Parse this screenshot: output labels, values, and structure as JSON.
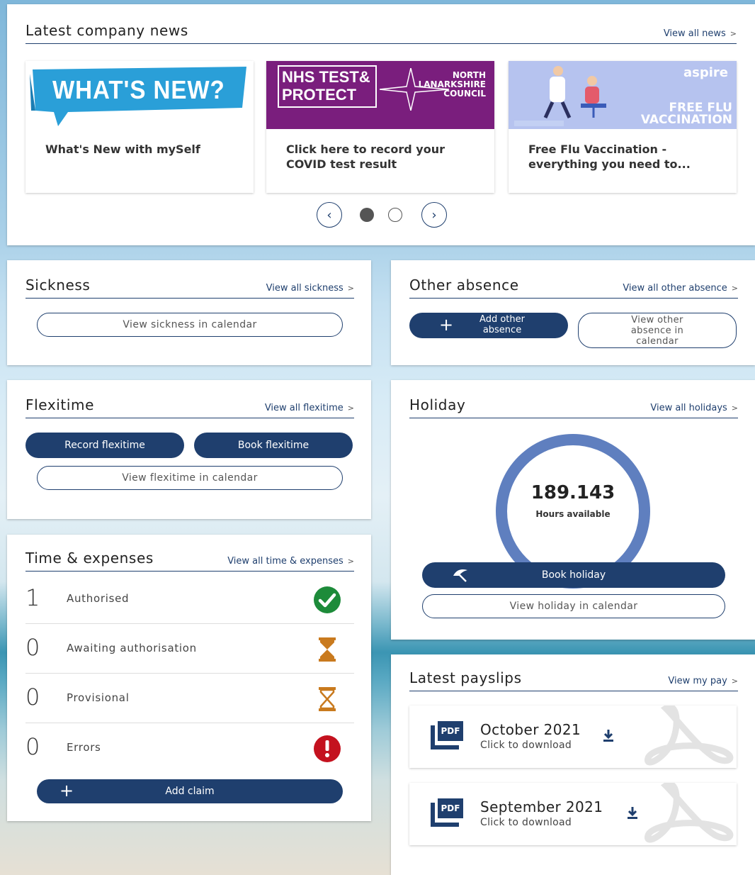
{
  "news": {
    "title": "Latest company news",
    "link": "View all news",
    "items": [
      {
        "image_text": "WHAT'S NEW?",
        "caption": "What's New with mySelf"
      },
      {
        "image_text_1": "NHS TEST& PROTECT",
        "image_text_2": "NORTH LANARKSHIRE COUNCIL",
        "caption": "Click here to record your COVID test result"
      },
      {
        "image_text_1": "aspire",
        "image_text_2": "FREE FLU VACCINATION",
        "caption": "Free Flu Vaccination - everything you need to..."
      }
    ]
  },
  "sickness": {
    "title": "Sickness",
    "link": "View all sickness",
    "calendar_button": "View sickness in calendar"
  },
  "other_absence": {
    "title": "Other absence",
    "link": "View all other absence",
    "add_button": "Add other absence",
    "calendar_button": "View other absence in calendar"
  },
  "flexitime": {
    "title": "Flexitime",
    "link": "View all flexitime",
    "record_button": "Record flexitime",
    "book_button": "Book flexitime",
    "calendar_button": "View flexitime in calendar"
  },
  "holiday": {
    "title": "Holiday",
    "link": "View all holidays",
    "hours": "189.143",
    "hours_label": "Hours available",
    "book_button": "Book holiday",
    "calendar_button": "View holiday in calendar"
  },
  "time_expenses": {
    "title": "Time & expenses",
    "link": "View all time & expenses",
    "rows": [
      {
        "count": "1",
        "label": "Authorised",
        "icon": "check-circle-icon"
      },
      {
        "count": "0",
        "label": "Awaiting authorisation",
        "icon": "hourglass-full-icon"
      },
      {
        "count": "0",
        "label": "Provisional",
        "icon": "hourglass-outline-icon"
      },
      {
        "count": "0",
        "label": "Errors",
        "icon": "error-circle-icon"
      }
    ],
    "add_button": "Add claim"
  },
  "payslips": {
    "title": "Latest payslips",
    "link": "View my pay",
    "items": [
      {
        "month": "October 2021",
        "sub": "Click to download"
      },
      {
        "month": "September 2021",
        "sub": "Click to download"
      }
    ],
    "pdf_label": "PDF"
  },
  "colors": {
    "primary": "#1f3f6e",
    "success": "#1d8b3a",
    "warning": "#c97a1e",
    "error": "#c4121f",
    "news_purple": "#7a1e7d"
  }
}
